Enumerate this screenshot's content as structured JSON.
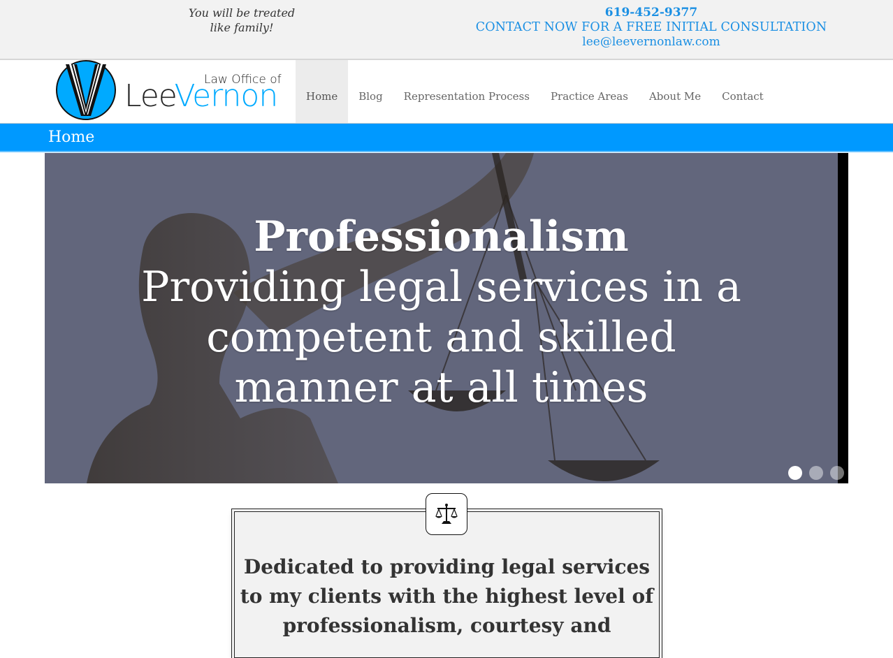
{
  "topbar": {
    "tagline_line1": "You will be treated",
    "tagline_line2": "like family!",
    "phone": "619-452-9377",
    "cta": "CONTACT NOW FOR A FREE INITIAL CONSULTATION",
    "email": "lee@leevernonlaw.com"
  },
  "logo": {
    "subtitle": "Law Office of",
    "name_first": "Lee",
    "name_last": "Vernon"
  },
  "nav": {
    "items": [
      "Home",
      "Blog",
      "Representation Process",
      "Practice Areas",
      "About Me",
      "Contact"
    ],
    "active": "Home"
  },
  "page_title": "Home",
  "hero": {
    "title": "Professionalism",
    "line1": "Providing legal services in a",
    "line2": "competent and skilled",
    "line3": "manner at all times",
    "slide_count": 3,
    "active_slide": 1
  },
  "card": {
    "icon": "scales-of-justice-icon",
    "line1": "Dedicated to providing legal services",
    "line2": "to my clients with the highest level of",
    "line3": "professionalism, courtesy and"
  },
  "colors": {
    "accent": "#0099ff",
    "logo_blue": "#00aaff",
    "hero_bg": "#62667c"
  }
}
